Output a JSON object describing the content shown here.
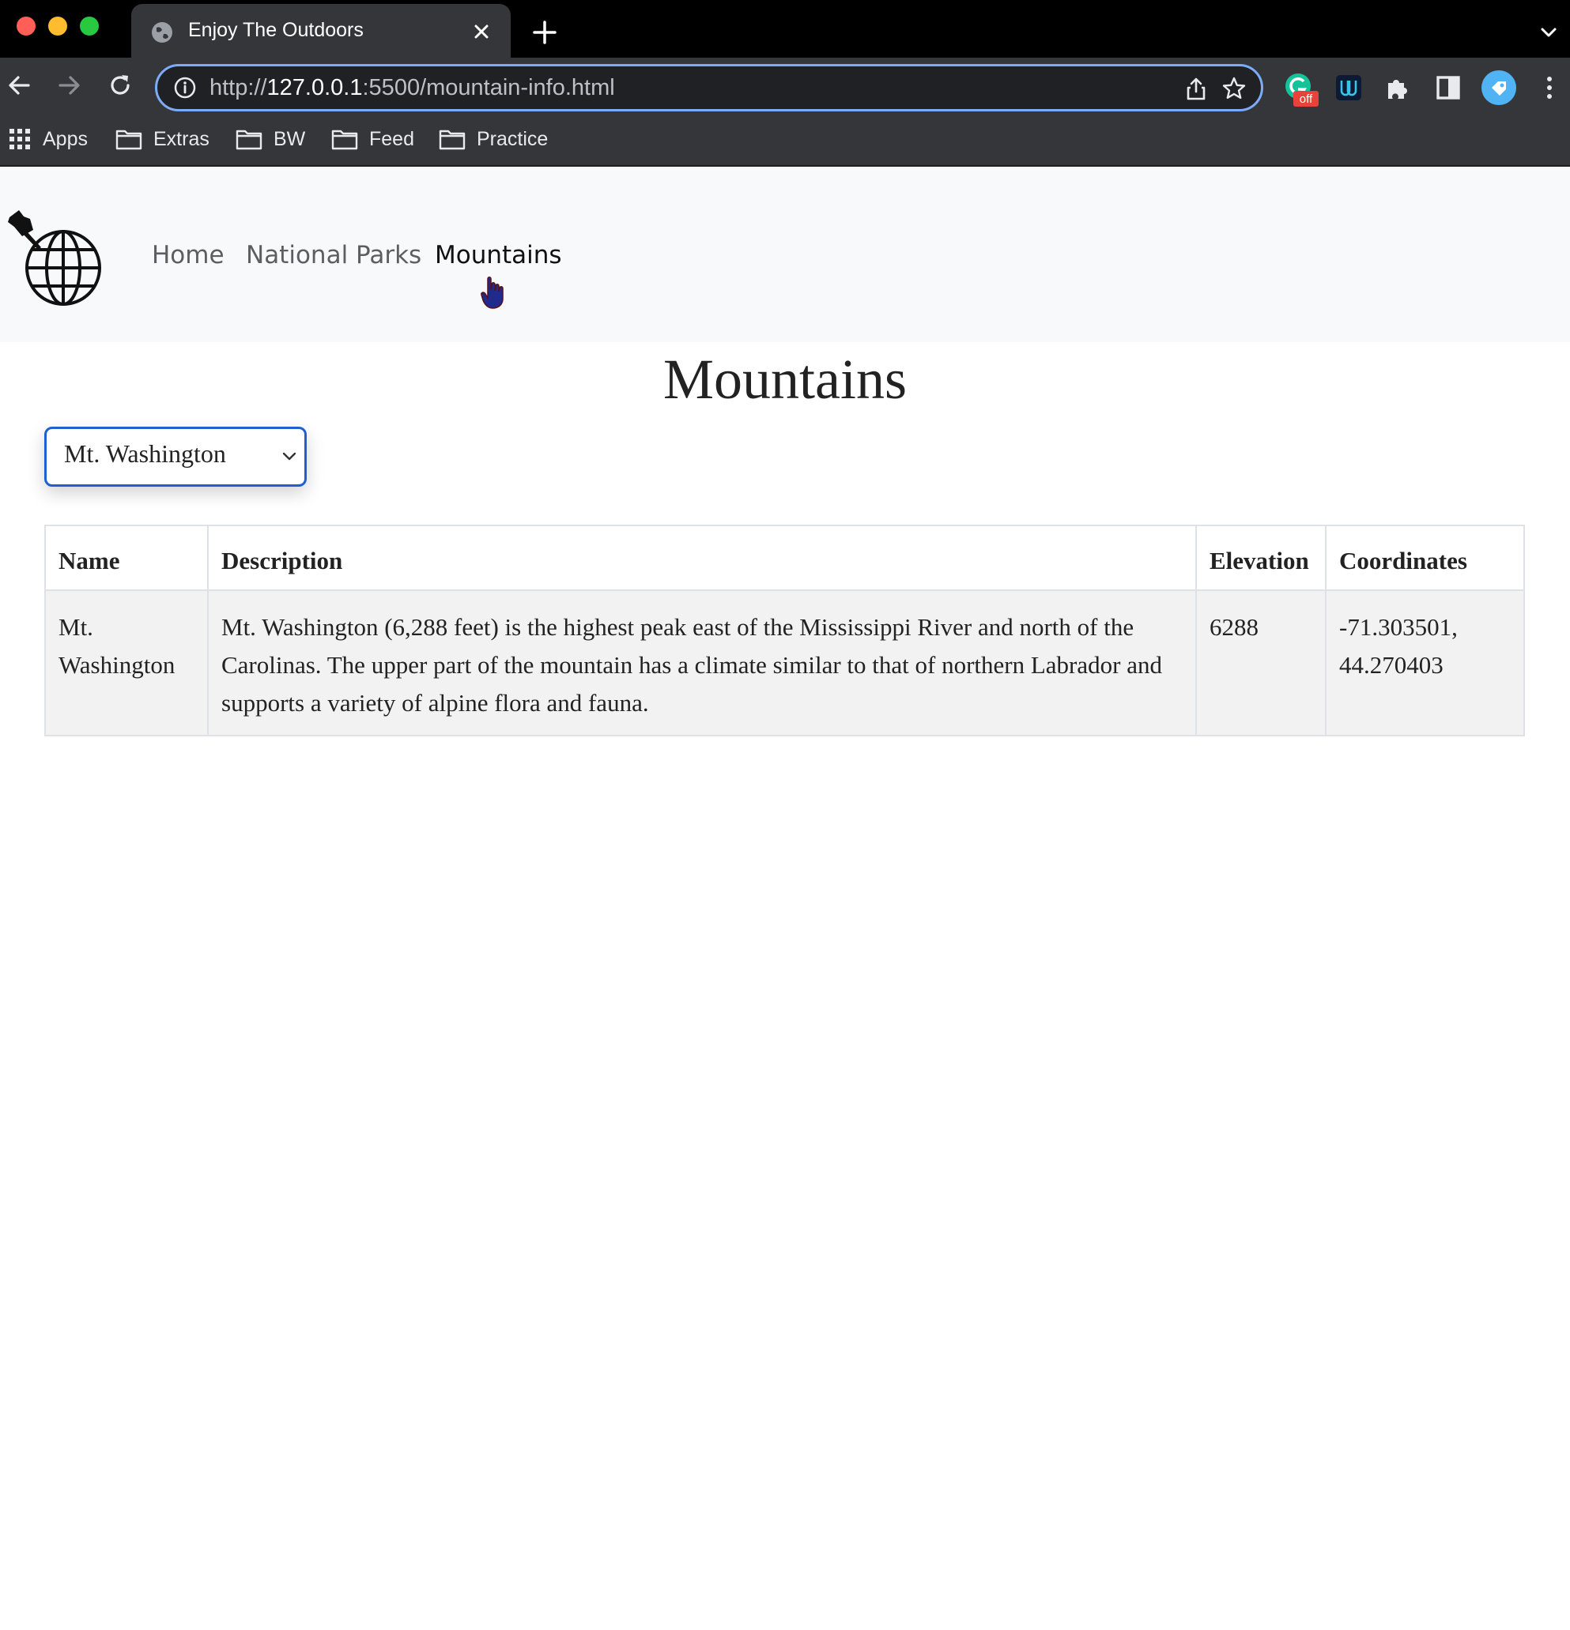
{
  "browser": {
    "tab_title": "Enjoy The Outdoors",
    "url_scheme": "http://",
    "url_host": "127.0.0.1",
    "url_rest": ":5500/mountain-info.html",
    "extension_badge": "off",
    "bookmarks": [
      "Apps",
      "Extras",
      "BW",
      "Feed",
      "Practice"
    ]
  },
  "site": {
    "nav": [
      "Home",
      "National Parks",
      "Mountains"
    ],
    "active_nav": "Mountains"
  },
  "page": {
    "title": "Mountains",
    "select": {
      "value": "Mt. Washington"
    },
    "table": {
      "headers": [
        "Name",
        "Description",
        "Elevation",
        "Coordinates"
      ],
      "rows": [
        {
          "name": "Mt. Washington",
          "description": "Mt. Washington (6,288 feet) is the highest peak east of the Mississippi River and north of the Carolinas. The upper part of the mountain has a climate similar to that of northern Labrador and supports a variety of alpine flora and fauna.",
          "elevation": "6288",
          "coordinates": "-71.303501, 44.270403"
        }
      ]
    }
  },
  "colors": {
    "omnibox_focus": "#7cacf8",
    "select_focus": "#1f5fd1",
    "header_bg": "#f8f9fa",
    "row_bg": "#f2f2f2"
  }
}
